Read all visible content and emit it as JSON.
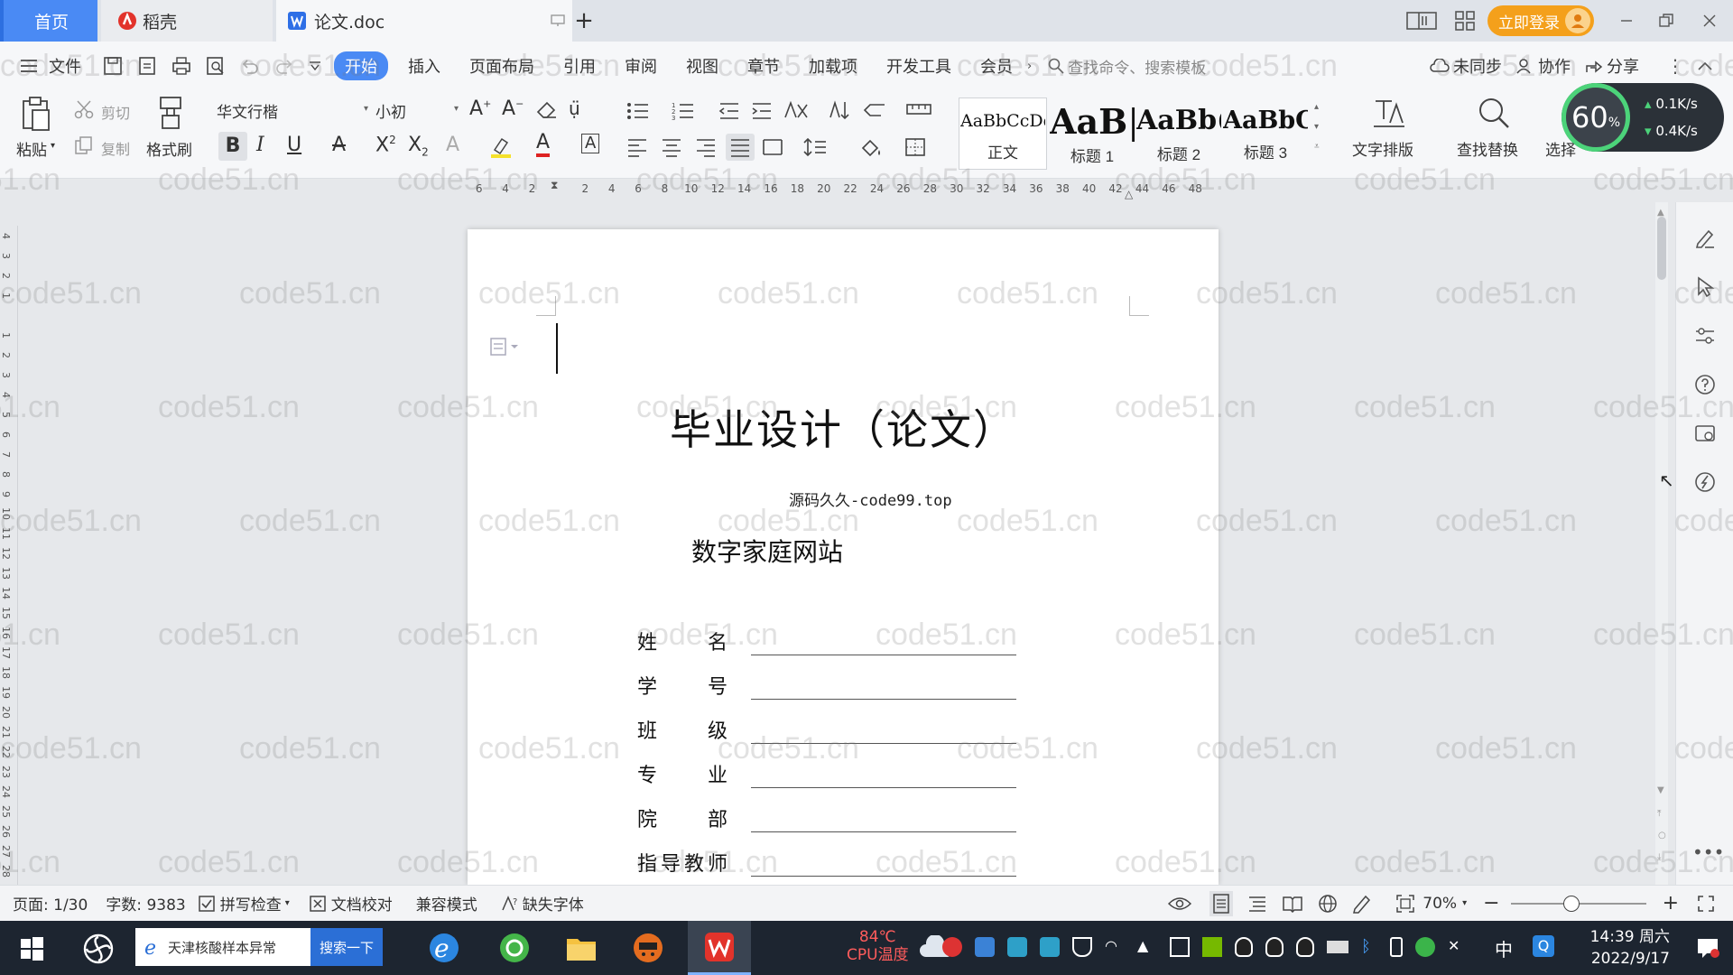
{
  "tabs": {
    "home": "首页",
    "daoke": "稻壳",
    "doc": "论文.doc"
  },
  "window": {
    "login": "立即登录"
  },
  "menu": {
    "file": "文件",
    "items": [
      "开始",
      "插入",
      "页面布局",
      "引用",
      "审阅",
      "视图",
      "章节",
      "加载项",
      "开发工具",
      "会员"
    ],
    "search_command": "查找命令、搜索模板",
    "sync": "未同步",
    "collab": "协作",
    "share": "分享"
  },
  "ribbon": {
    "paste": "粘贴",
    "cut": "剪切",
    "copy": "复制",
    "format_painter": "格式刷",
    "font_name": "华文行楷",
    "font_size": "小初",
    "styles": [
      {
        "sample": "AaBbCcDd",
        "label": "正文"
      },
      {
        "sample": "AaB|",
        "label": "标题 1"
      },
      {
        "sample": "AaBb(",
        "label": "标题 2"
      },
      {
        "sample": "AaBbC",
        "label": "标题 3"
      }
    ],
    "text_layout": "文字排版",
    "find_replace": "查找替换",
    "select": "选择"
  },
  "ruler": {
    "h_ticks": [
      "6",
      "4",
      "2",
      "",
      "2",
      "4",
      "6",
      "8",
      "10",
      "12",
      "14",
      "16",
      "18",
      "20",
      "22",
      "24",
      "26",
      "28",
      "30",
      "32",
      "34",
      "36",
      "38",
      "40",
      "42",
      "44",
      "46",
      "48"
    ],
    "v_ticks": [
      "4",
      "3",
      "2",
      "1",
      "",
      "1",
      "2",
      "3",
      "4",
      "5",
      "6",
      "7",
      "8",
      "9",
      "10",
      "11",
      "12",
      "13",
      "14",
      "15",
      "16",
      "17",
      "18",
      "19",
      "20",
      "21",
      "22",
      "23",
      "24",
      "25",
      "26",
      "27",
      "28"
    ]
  },
  "document": {
    "title": "毕业设计（论文）",
    "source": "源码久久-code99.top",
    "subtitle": "数字家庭网站",
    "fields": [
      {
        "a": "姓",
        "b": "名"
      },
      {
        "a": "学",
        "b": "号"
      },
      {
        "a": "班",
        "b": "级"
      },
      {
        "a": "专",
        "b": "业"
      },
      {
        "a": "院",
        "b": "部"
      },
      {
        "a": "指导教师",
        "b": ""
      }
    ]
  },
  "speed": {
    "percent": "60",
    "unit": "%",
    "up": "0.1K/s",
    "down": "0.4K/s"
  },
  "status": {
    "page": "页面: 1/30",
    "words": "字数: 9383",
    "spell": "拼写检查",
    "proof": "文档校对",
    "compat": "兼容模式",
    "missing_font": "缺失字体",
    "zoom": "70%"
  },
  "taskbar": {
    "search_text": "天津核酸样本异常",
    "search_btn": "搜索一下",
    "cpu_temp": "84℃",
    "cpu_label": "CPU温度",
    "ime": "中",
    "time": "14:39 周六",
    "date": "2022/9/17"
  },
  "watermark": "code51.cn",
  "colors": {
    "accent": "#4a8af4",
    "login": "#f4a01b",
    "taskbar": "#1d2530"
  }
}
